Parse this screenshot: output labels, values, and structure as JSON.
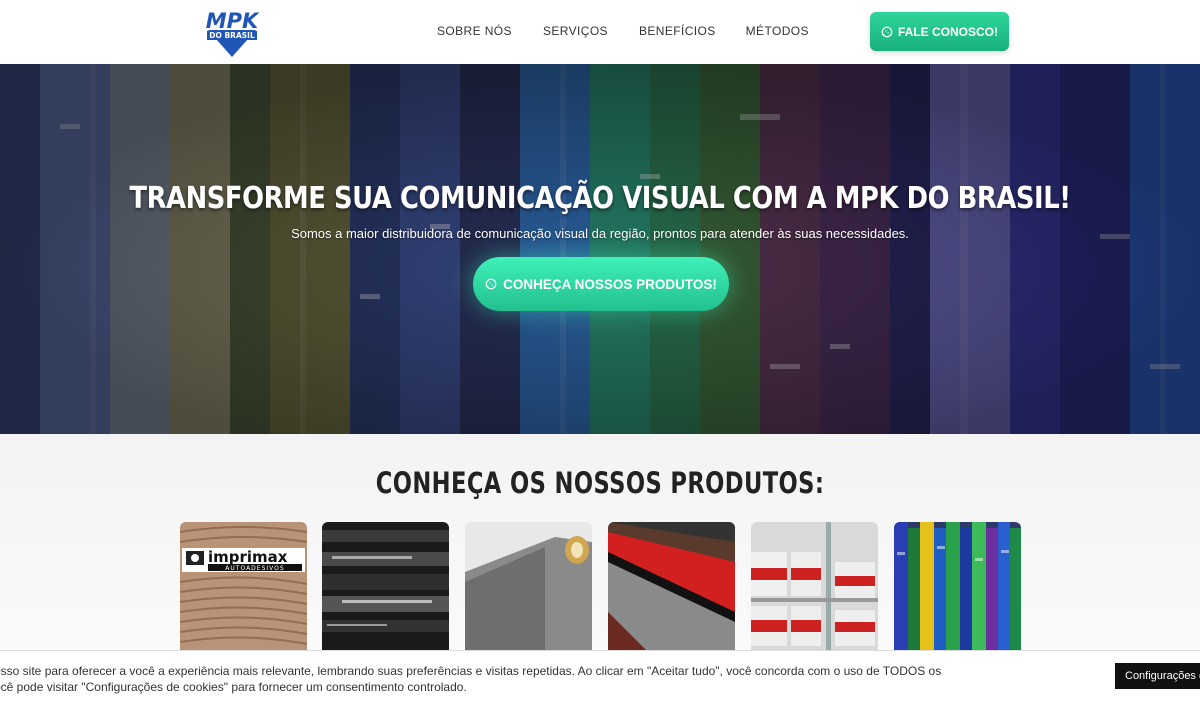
{
  "header": {
    "logo_text": "MPK",
    "logo_sub": "DO BRASIL",
    "nav": [
      "SOBRE NÓS",
      "SERVIÇOS",
      "BENEFÍCIOS",
      "MÉTODOS"
    ],
    "cta_label": "FALE CONOSCO!"
  },
  "hero": {
    "title": "TRANSFORME SUA COMUNICAÇÃO VISUAL COM A MPK DO BRASIL!",
    "subtitle": "Somos a maior distribuidora de comunicação visual da região, prontos para atender às suas necessidades.",
    "button_label": "CONHEÇA NOSSOS PRODUTOS!"
  },
  "products": {
    "title": "CONHEÇA OS NOSSOS PRODUTOS:",
    "card1_brand": "imprimax",
    "card1_sub": "AUTOADESIVOS"
  },
  "cookie": {
    "line1": "osso site para oferecer a você a experiência mais relevante, lembrando suas preferências e visitas repetidas. Ao clicar em \"Aceitar tudo\", você concorda com o uso de TODOS os",
    "line2": "ocê pode visitar \"Configurações de cookies\" para fornecer um consentimento controlado.",
    "settings_label": "Configurações de"
  },
  "colors": {
    "accent_green": "#22c08e",
    "logo_blue": "#1f56b8"
  }
}
